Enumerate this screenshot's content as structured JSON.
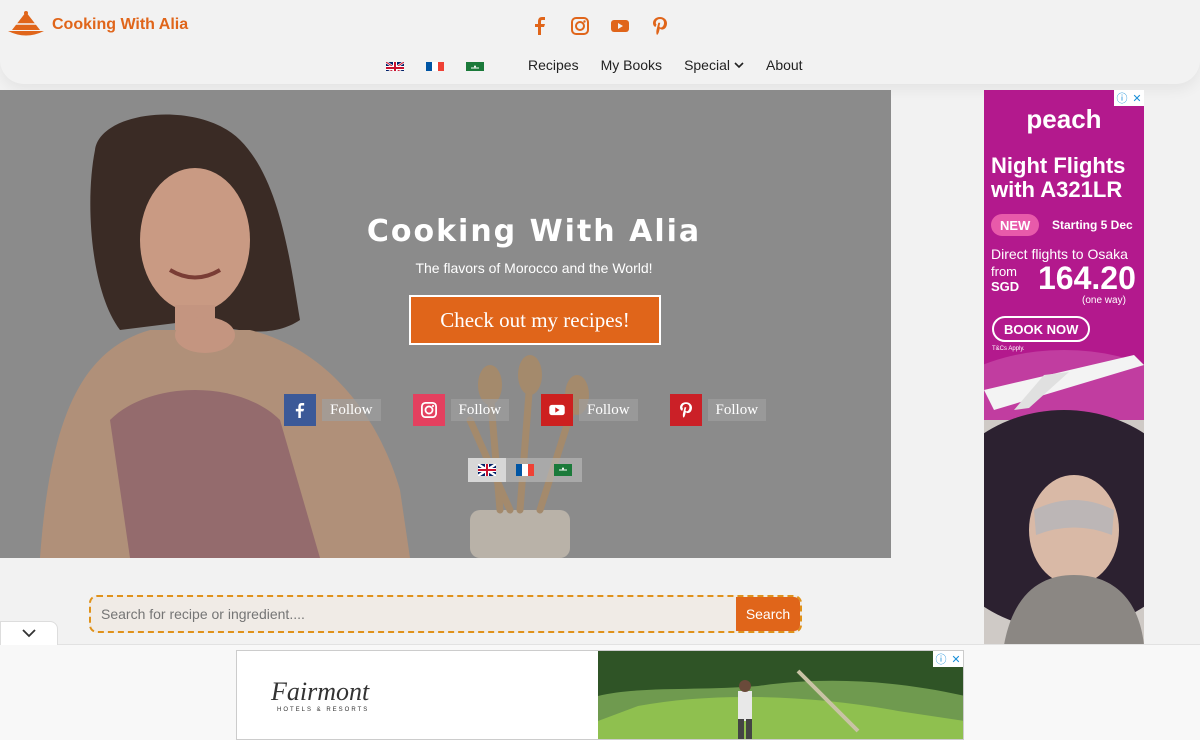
{
  "header": {
    "logo_text": "Cooking With Alia",
    "social": [
      "facebook-icon",
      "instagram-icon",
      "youtube-icon",
      "pinterest-icon"
    ],
    "nav": [
      {
        "label": "Recipes"
      },
      {
        "label": "My Books"
      },
      {
        "label": "Special"
      },
      {
        "label": "About"
      }
    ],
    "languages": [
      "English",
      "Français",
      "العربية"
    ]
  },
  "hero": {
    "title": "Cooking With Alia",
    "subtitle": "The flavors of Morocco and the World!",
    "cta": "Check out my recipes!",
    "follow": [
      {
        "network": "facebook",
        "label": "Follow",
        "color": "#3b5998"
      },
      {
        "network": "instagram",
        "label": "Follow",
        "color": "#e4405f"
      },
      {
        "network": "youtube",
        "label": "Follow",
        "color": "#cd201f"
      },
      {
        "network": "pinterest",
        "label": "Follow",
        "color": "#cb2027"
      }
    ]
  },
  "search": {
    "placeholder": "Search for recipe or ingredient....",
    "button": "Search"
  },
  "ad_right": {
    "brand": "peach",
    "headline": "Night Flights with A321LR",
    "badge": "NEW",
    "starting": "Starting 5 Dec",
    "direct": "Direct flights to Osaka",
    "from": "from",
    "currency": "SGD",
    "price": "164.20",
    "oneway": "(one way)",
    "book": "BOOK NOW",
    "tcs": "T&Cs Apply."
  },
  "ad_bottom": {
    "brand": "Fairmont",
    "sub": "HOTELS & RESORTS"
  },
  "colors": {
    "accent": "#e0651a",
    "ad_purple": "#b3198d"
  }
}
